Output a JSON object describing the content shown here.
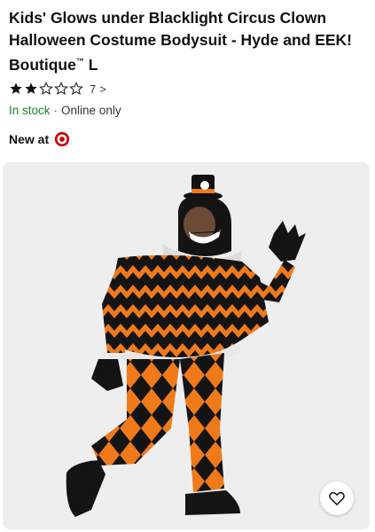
{
  "product": {
    "title": "Kids' Glows under Blacklight Circus Clown Halloween Costume Bodysuit - Hyde and EEK! Boutique",
    "title_trademark": "™",
    "title_size": " L",
    "rating": {
      "stars_filled": 2,
      "stars_total": 5,
      "count": "7",
      "chevron": ">"
    },
    "availability": {
      "in_stock": "In stock",
      "separator": "·",
      "channel": "Online only"
    },
    "new_at": "New at",
    "brand_logo_icon": "target-bullseye-icon",
    "image_alt": "Child wearing orange and black harlequin clown costume with mini top hat",
    "favorite_icon": "heart-icon"
  },
  "colors": {
    "in_stock_green": "#1a7f2e",
    "target_red": "#cc0000",
    "costume_orange": "#f07a1a",
    "costume_black": "#141414"
  }
}
